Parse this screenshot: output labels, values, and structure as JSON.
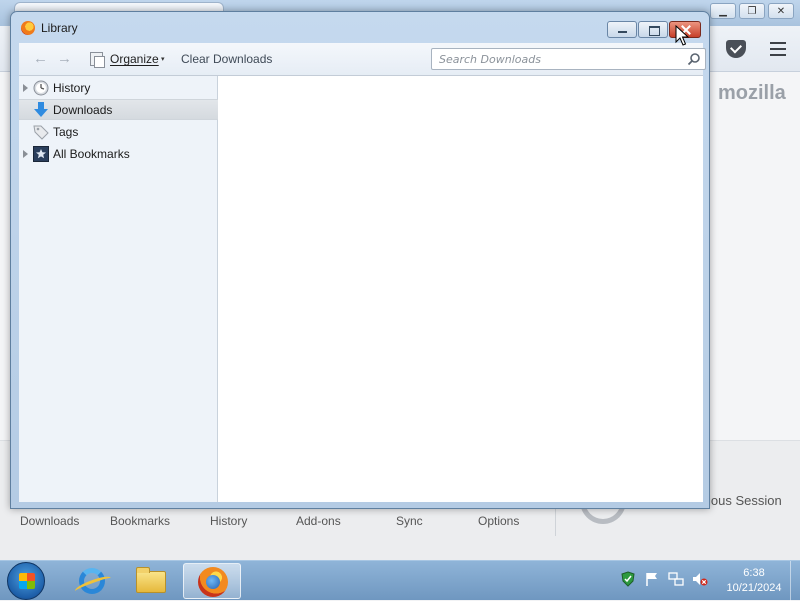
{
  "background_window": {
    "brand_text": "mozilla",
    "restore_text": "ious Session",
    "launchers": [
      "Downloads",
      "Bookmarks",
      "History",
      "Add-ons",
      "Sync",
      "Options"
    ]
  },
  "library": {
    "title": "Library",
    "toolbar": {
      "organize_label": "Organize",
      "organize_arrow": "▾",
      "clear_label": "Clear Downloads",
      "back_glyph": "←",
      "forward_glyph": "→",
      "search_placeholder": "Search Downloads",
      "search_value": ""
    },
    "sidebar": {
      "items": [
        {
          "label": "History",
          "icon": "clock-icon",
          "expandable": true,
          "selected": false
        },
        {
          "label": "Downloads",
          "icon": "download-arrow-icon",
          "expandable": false,
          "selected": true
        },
        {
          "label": "Tags",
          "icon": "tag-icon",
          "expandable": false,
          "selected": false
        },
        {
          "label": "All Bookmarks",
          "icon": "star-bookmarks-icon",
          "expandable": true,
          "selected": false
        }
      ]
    },
    "content": {
      "items": []
    }
  },
  "taskbar": {
    "clock": {
      "time": "6:38",
      "date": "10/21/2024"
    },
    "apps": [
      "internet-explorer-icon",
      "file-explorer-icon",
      "firefox-icon"
    ],
    "active_app": "firefox-icon"
  },
  "colors": {
    "accent": "#1e78d7",
    "close_button": "#c7402a",
    "selection": "#d9dde2"
  }
}
